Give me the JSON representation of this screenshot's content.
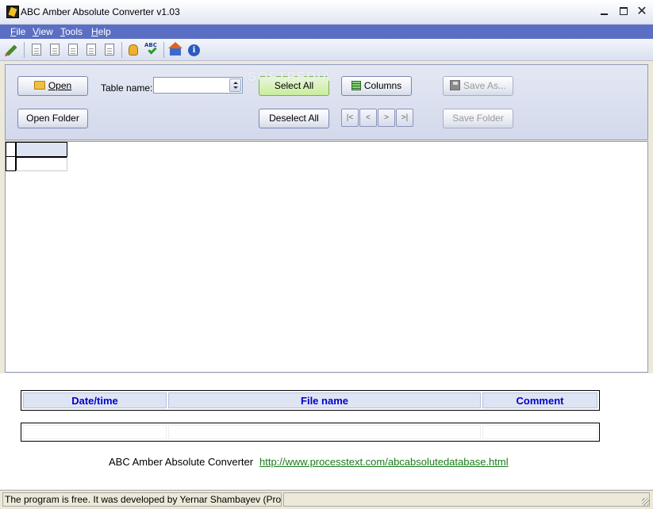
{
  "window": {
    "title": "ABC Amber Absolute Converter v1.03"
  },
  "menu": {
    "items": [
      {
        "label": "File"
      },
      {
        "label": "View"
      },
      {
        "label": "Tools"
      },
      {
        "label": "Help"
      }
    ]
  },
  "toolbar": {
    "icons": [
      "pencil-icon",
      "export-xls-icon",
      "export-doc-icon",
      "export-pdf-icon",
      "export-html-icon",
      "export-rtf-icon",
      "hand-icon",
      "spellcheck-icon",
      "home-icon",
      "info-icon"
    ]
  },
  "panel": {
    "open_label": "Open",
    "open_folder_label": "Open Folder",
    "table_name_label": "Table name:",
    "table_name_value": "",
    "select_all_label": "Select All",
    "deselect_all_label": "Deselect All",
    "columns_label": "Columns",
    "save_as_label": "Save As...",
    "save_folder_label": "Save Folder",
    "nav": [
      "|<",
      "<",
      ">",
      ">|"
    ]
  },
  "log_table": {
    "headers": [
      "Date/time",
      "File name",
      "Comment"
    ],
    "rows": [
      [
        "",
        "",
        ""
      ]
    ]
  },
  "footer": {
    "app_name": "ABC Amber Absolute Converter",
    "url": "http://www.processtext.com/abcabsolutedatabase.html"
  },
  "status": {
    "text": "The program is free. It was developed by Yernar Shambayev (Proce"
  },
  "watermark": "SOFTPEDIA",
  "colors": {
    "menu_bg": "#5a6fc3",
    "header_text": "#0000cc",
    "link": "#1a7a1a",
    "select_all_bg": "#c9ec9e"
  }
}
